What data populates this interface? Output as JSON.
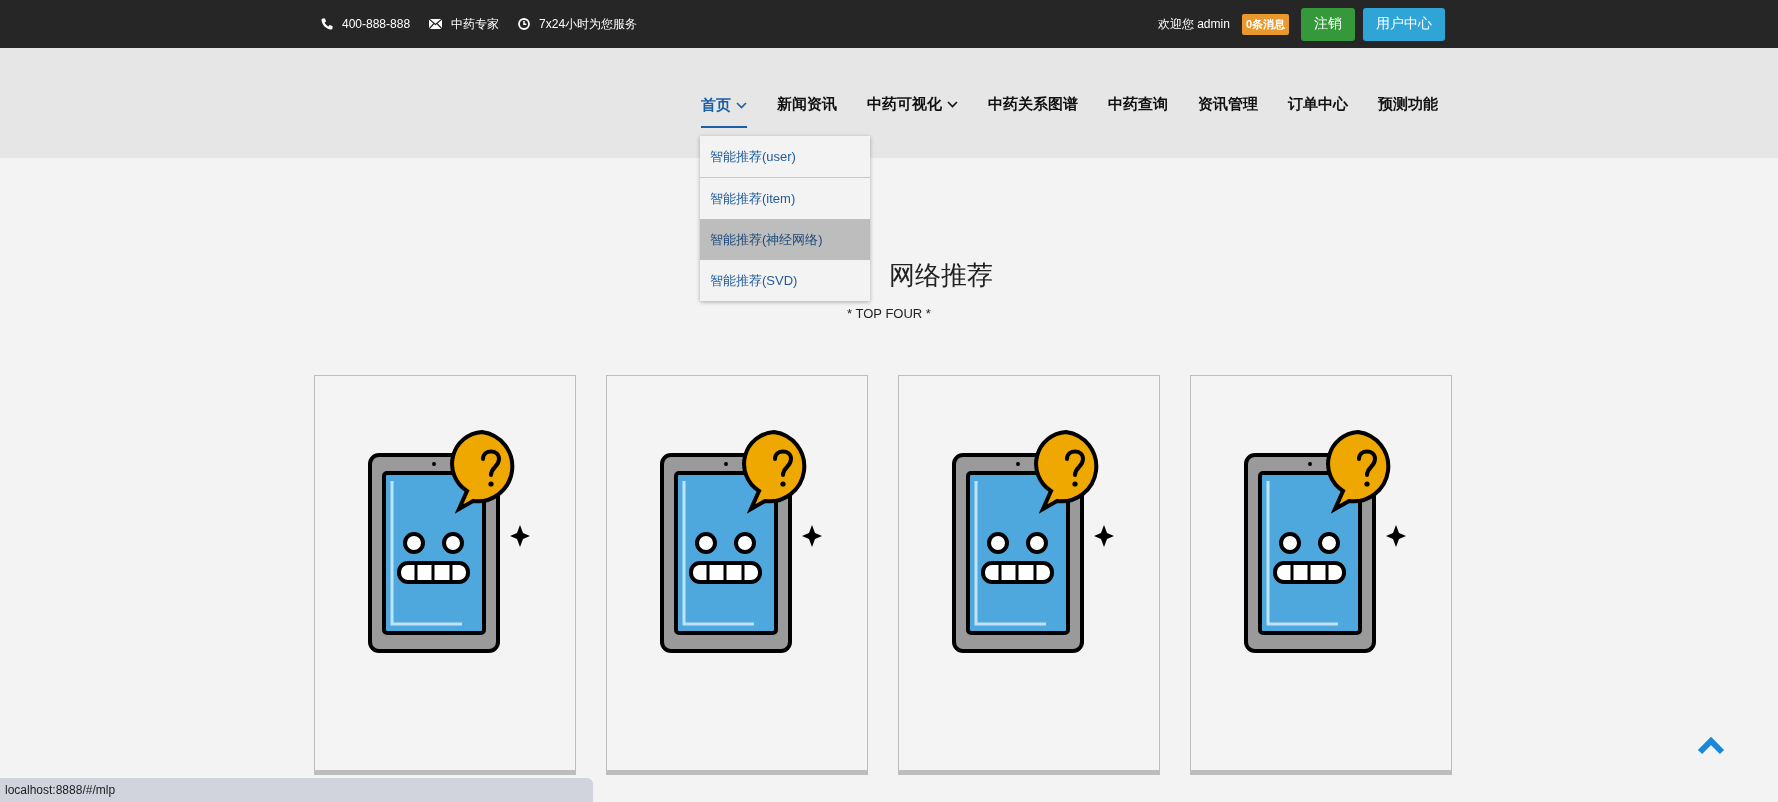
{
  "top_bar": {
    "phone": "400-888-888",
    "email": "中药专家",
    "hours": "7x24小时为您服务",
    "welcome": "欢迎您 admin",
    "messages_badge": "0条消息",
    "logout_button": "注销",
    "user_center_button": "用户中心"
  },
  "nav": [
    {
      "label": "首页",
      "has_menu": true,
      "selected": true
    },
    {
      "label": "新闻资讯",
      "has_menu": false,
      "selected": false
    },
    {
      "label": "中药可视化",
      "has_menu": true,
      "selected": false
    },
    {
      "label": "中药关系图谱",
      "has_menu": false,
      "selected": false
    },
    {
      "label": "中药查询",
      "has_menu": false,
      "selected": false
    },
    {
      "label": "资讯管理",
      "has_menu": false,
      "selected": false
    },
    {
      "label": "订单中心",
      "has_menu": false,
      "selected": false
    },
    {
      "label": "预测功能",
      "has_menu": false,
      "selected": false
    }
  ],
  "dropdown": [
    {
      "label": "智能推荐(user)",
      "selected": false
    },
    {
      "label": "智能推荐(item)",
      "selected": false
    },
    {
      "label": "智能推荐(神经网络)",
      "selected": true
    },
    {
      "label": "智能推荐(SVD)",
      "selected": false
    }
  ],
  "section": {
    "title": "网络推荐",
    "subtitle": "* TOP FOUR *"
  },
  "cards": [
    {
      "kind": "robot"
    },
    {
      "kind": "robot"
    },
    {
      "kind": "robot"
    },
    {
      "kind": "robot"
    }
  ],
  "status_url": "localhost:8888/#/mlp"
}
